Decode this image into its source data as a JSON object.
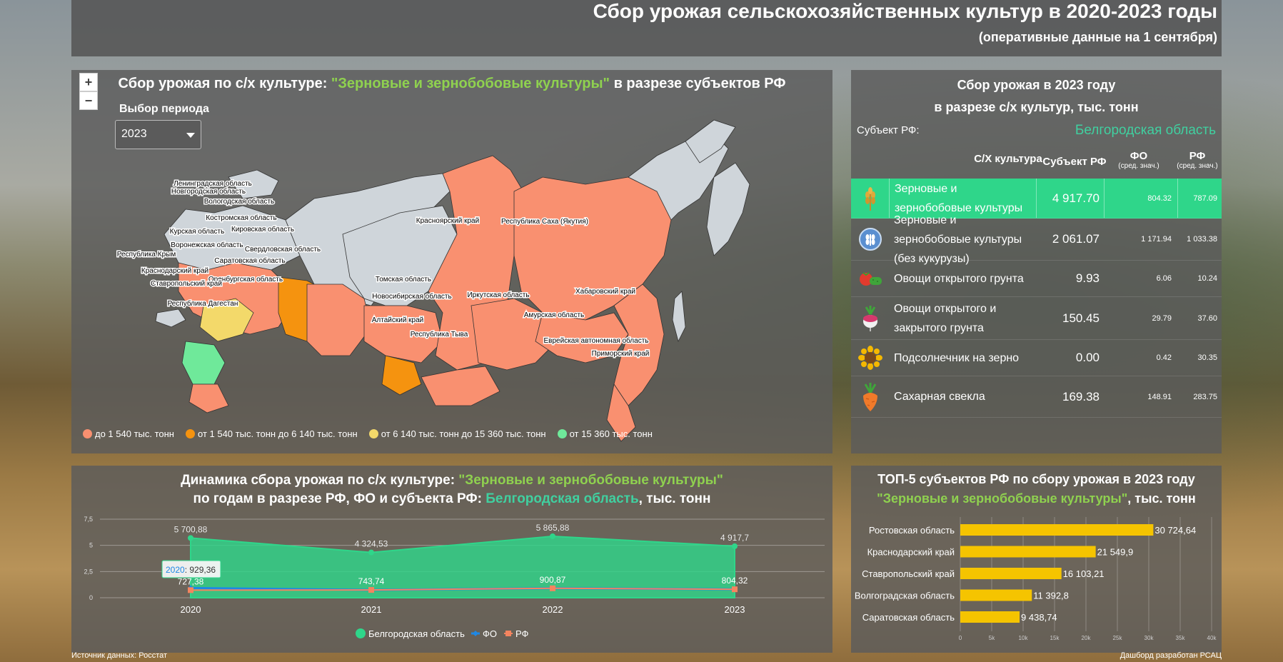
{
  "header": {
    "title": "Сбор урожая сельскохозяйственных культур в 2020-2023 годы",
    "subtitle": "(оперативные данные на 1 сентября)"
  },
  "map": {
    "title_prefix": "Сбор урожая по с/х культуре: ",
    "title_crop": "\"Зерновые и зернобобовые культуры\"",
    "title_suffix": " в разрезе субъектов РФ",
    "zoom_in": "+",
    "zoom_out": "−",
    "period_label": "Выбор периода",
    "period_value": "2023",
    "colors": {
      "low": "#f99070",
      "mid": "#f5930f",
      "high": "#f3d96a",
      "top": "#6fe99a",
      "none": "#cfd5da"
    },
    "legend": [
      {
        "label": "до 1 540 тыс. тонн",
        "color": "#f99070"
      },
      {
        "label": "от 1 540 тыс. тонн до 6 140 тыс. тонн",
        "color": "#f5930f"
      },
      {
        "label": "от 6 140 тыс. тонн до 15 360 тыс. тонн",
        "color": "#f3d96a"
      },
      {
        "label": "от 15 360 тыс. тонн",
        "color": "#6fe99a"
      }
    ],
    "region_labels": [
      "Ленинградская область",
      "Новгородская область",
      "Вологодская область",
      "Костромская область",
      "Курская область",
      "Кировская область",
      "Воронежская область",
      "Свердловская область",
      "Республика Крым",
      "Саратовская область",
      "Краснодарский край",
      "Оренбургская область",
      "Ставропольский край",
      "Республика Дагестан",
      "Томская область",
      "Новосибирская область",
      "Алтайский край",
      "Республика Тыва",
      "Красноярский край",
      "Республика Саха (Якутия)",
      "Иркутская область",
      "Хабаровский край",
      "Амурская область",
      "Еврейская автономная область",
      "Приморский край"
    ]
  },
  "table": {
    "title_line1": "Сбор урожая в 2023 году",
    "title_line2": "в разрезе с/х культур, тыс. тонн",
    "subject_label": "Субъект РФ:",
    "subject_value": "Белгородская область",
    "col_crop": "С/Х культура",
    "col_subject": "Субъект РФ",
    "col_fo": "ФО",
    "col_fo_note": "(сред. знач.)",
    "col_rf": "РФ",
    "col_rf_note": "(сред. знач.)",
    "rows": [
      {
        "icon": "wheat-icon",
        "name": "Зерновые и зернобобовые культуры",
        "subject": "4 917.70",
        "fo": "804.32",
        "rf": "787.09"
      },
      {
        "icon": "grain-badge-icon",
        "name": "Зерновые и зернобобовые культуры (без кукурузы)",
        "subject": "2 061.07",
        "fo": "1 171.94",
        "rf": "1 033.38"
      },
      {
        "icon": "vegetables-icon",
        "name": "Овощи открытого грунта",
        "subject": "9.93",
        "fo": "6.06",
        "rf": "10.24"
      },
      {
        "icon": "radish-icon",
        "name": "Овощи открытого и закрытого грунта",
        "subject": "150.45",
        "fo": "29.79",
        "rf": "37.60"
      },
      {
        "icon": "sunflower-icon",
        "name": "Подсолнечник на зерно",
        "subject": "0.00",
        "fo": "0.42",
        "rf": "30.35"
      },
      {
        "icon": "sugar-beet-icon",
        "name": "Сахарная свекла",
        "subject": "169.38",
        "fo": "148.91",
        "rf": "283.75"
      }
    ]
  },
  "dynamics": {
    "title_line1_prefix": "Динамика сбора урожая по с/х культуре: ",
    "title_line1_crop": "\"Зерновые и зернобобовые культуры\"",
    "title_line2_prefix": "по годам в разрезе РФ, ФО и субъекта РФ: ",
    "title_line2_subject": "Белгородская область",
    "title_line2_suffix": ", тыс. тонн",
    "tooltip_year": "2020",
    "tooltip_value": ": 929,36",
    "legend": [
      "Белгородская область",
      "ФО",
      "РФ"
    ]
  },
  "chart_data": [
    {
      "type": "area",
      "x": [
        "2020",
        "2021",
        "2022",
        "2023"
      ],
      "ylim": [
        0,
        7.5
      ],
      "y_ticks": [
        "0",
        "2,5",
        "5",
        "7,5"
      ],
      "series": [
        {
          "name": "Белгородская область",
          "values": [
            5700.88,
            4324.53,
            5865.88,
            4917.7
          ],
          "labels": [
            "5 700,88",
            "4 324,53",
            "5 865,88",
            "4 917,7"
          ],
          "color": "#2fd68a"
        },
        {
          "name": "ФО",
          "values": [
            929.36,
            743.74,
            900.87,
            804.32
          ],
          "labels": [
            "",
            "",
            "",
            ""
          ],
          "color": "#1e88e5"
        },
        {
          "name": "РФ",
          "values": [
            727.38,
            743.74,
            900.87,
            804.32
          ],
          "labels": [
            "727,38",
            "743,74",
            "900,87",
            "804,32"
          ],
          "color": "#f4845f"
        }
      ]
    },
    {
      "type": "bar",
      "title_line1": "ТОП-5 субъектов РФ по сбору урожая в 2023 году",
      "title_crop": "\"Зерновые и зернобобовые культуры\"",
      "title_suffix": ", тыс. тонн",
      "categories": [
        "Ростовская область",
        "Краснодарский край",
        "Ставропольский край",
        "Волгоградская область",
        "Саратовская область"
      ],
      "values": [
        30724.64,
        21549.9,
        16103.21,
        11392.8,
        9438.74
      ],
      "labels": [
        "30 724,64",
        "21 549,9",
        "16 103,21",
        "11 392,8",
        "9 438,74"
      ],
      "xlim": [
        0,
        40000
      ],
      "x_ticks": [
        "0",
        "5k",
        "10k",
        "15k",
        "20k",
        "25k",
        "30k",
        "35k",
        "40k"
      ],
      "color": "#f5c400"
    }
  ],
  "footer": {
    "source": "Источник данных: Росстат",
    "credit": "Дашборд разработан РСАЦ"
  }
}
